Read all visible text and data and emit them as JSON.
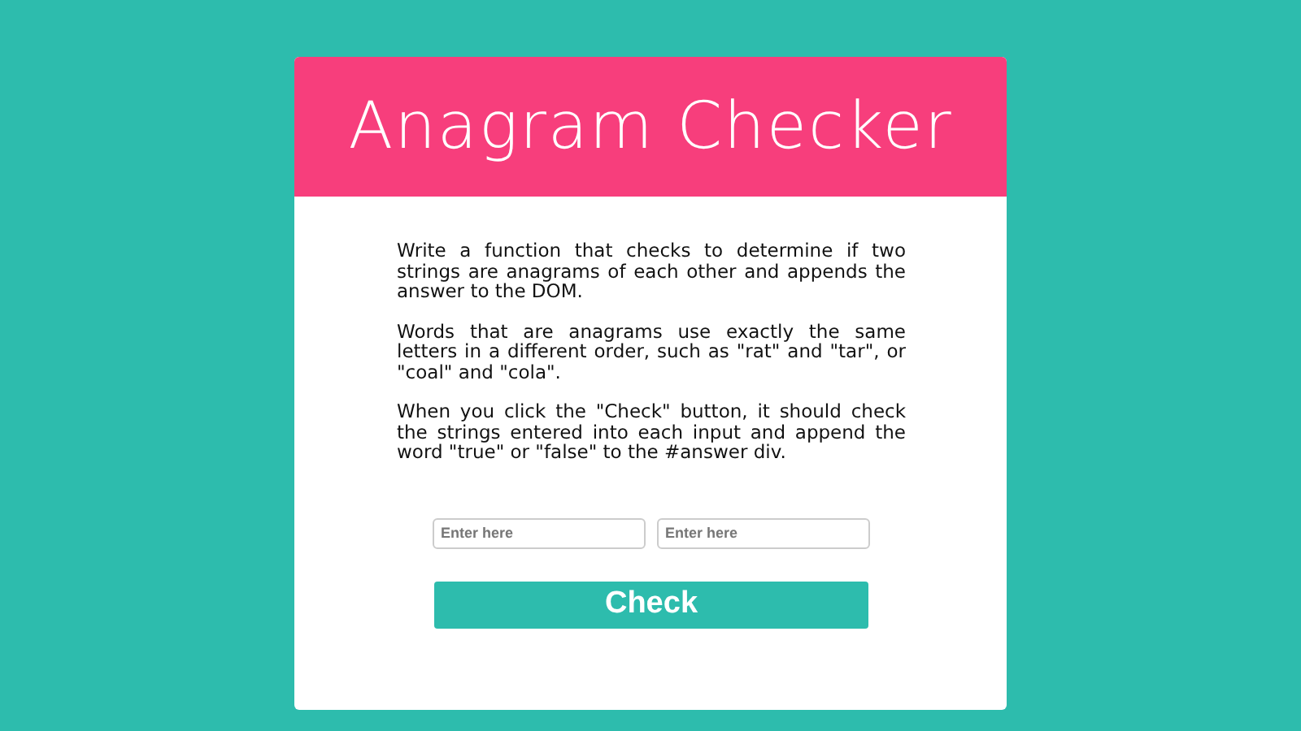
{
  "header": {
    "title": "Anagram Checker"
  },
  "paragraphs": [
    "Write a function that checks to determine if two strings are anagrams of each other and appends the answer to the DOM.",
    "Words that are anagrams use exactly the same letters in a different order, such as \"rat\" and \"tar\", or \"coal\" and \"cola\".",
    "When you click the \"Check\" button, it should check the strings entered into each input and append the word \"true\" or \"false\" to the #answer div."
  ],
  "inputs": [
    {
      "placeholder": "Enter here"
    },
    {
      "placeholder": "Enter here"
    }
  ],
  "button": {
    "label": "Check"
  }
}
